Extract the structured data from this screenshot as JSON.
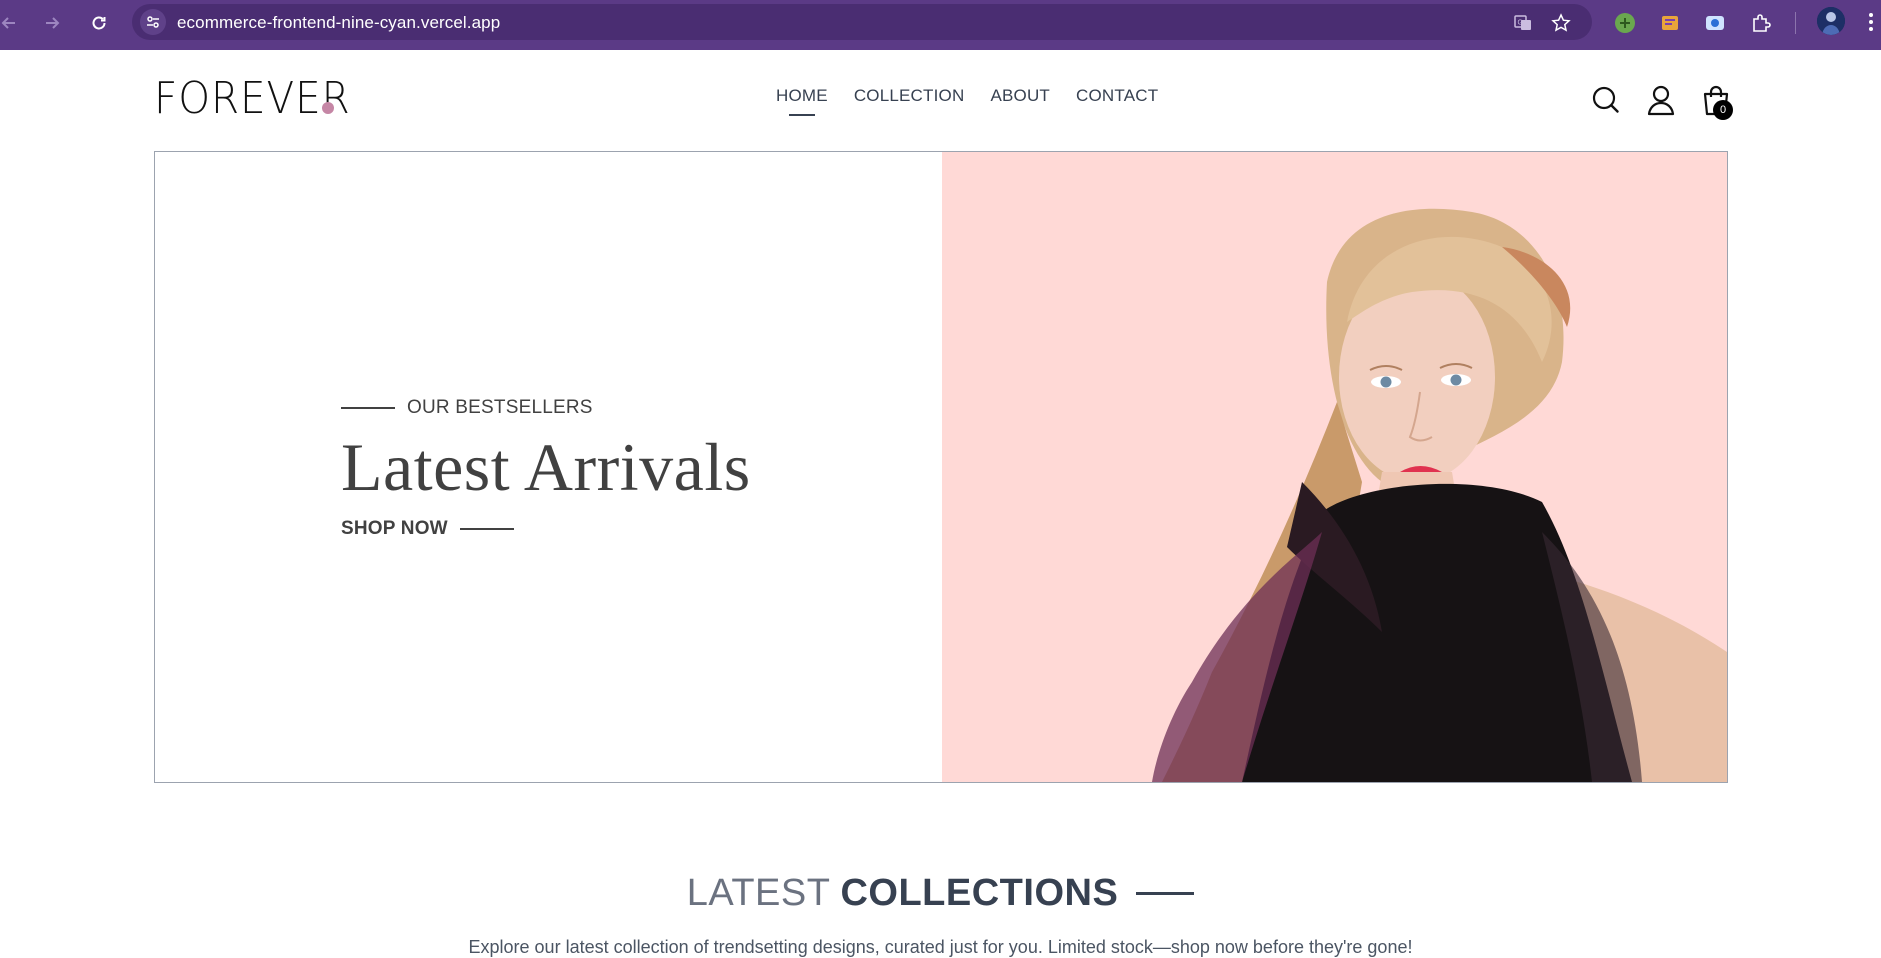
{
  "browser": {
    "url": "ecommerce-frontend-nine-cyan.vercel.app",
    "back_icon": "arrow-left-icon",
    "forward_icon": "arrow-right-icon",
    "reload_icon": "reload-icon",
    "toolbar_color": "#5b3a86"
  },
  "header": {
    "logo": "FOREVER",
    "logo_dot_color": "#c586a5",
    "nav": [
      {
        "label": "HOME",
        "active": true
      },
      {
        "label": "COLLECTION",
        "active": false
      },
      {
        "label": "ABOUT",
        "active": false
      },
      {
        "label": "CONTACT",
        "active": false
      }
    ],
    "cart_count": "0"
  },
  "hero": {
    "eyebrow": "OUR BESTSELLERS",
    "title": "Latest Arrivals",
    "cta": "SHOP NOW",
    "image_bg": "#ffd9d6"
  },
  "latest": {
    "title_light": "LATEST",
    "title_bold": "COLLECTIONS",
    "description": "Explore our latest collection of trendsetting designs, curated just for you. Limited stock—shop now before they're gone!"
  }
}
